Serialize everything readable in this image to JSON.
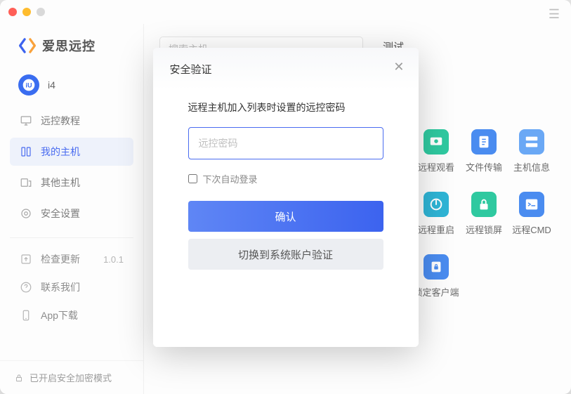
{
  "brand": {
    "name": "爱思远控"
  },
  "user": {
    "name": "i4"
  },
  "sidebar": {
    "items": [
      {
        "label": "远控教程"
      },
      {
        "label": "我的主机"
      },
      {
        "label": "其他主机"
      },
      {
        "label": "安全设置"
      }
    ],
    "utility": [
      {
        "label": "检查更新",
        "version": "1.0.1"
      },
      {
        "label": "联系我们"
      },
      {
        "label": "App下载"
      }
    ],
    "encrypt_label": "已开启安全加密模式"
  },
  "main": {
    "search_placeholder": "搜索主机",
    "host_title": "测试"
  },
  "actions": [
    {
      "label": "远程观看",
      "color": "#2fc9a0"
    },
    {
      "label": "文件传输",
      "color": "#4a8cf0"
    },
    {
      "label": "主机信息",
      "color": "#6aa8f5"
    },
    {
      "label": "远程重启",
      "color": "#2fb5d6"
    },
    {
      "label": "远程锁屏",
      "color": "#2fc9a0"
    },
    {
      "label": "远程CMD",
      "color": "#4a8cf0"
    },
    {
      "label": "锁定客户端",
      "color": "#4a8cf0"
    }
  ],
  "dialog": {
    "title": "安全验证",
    "subtitle": "远程主机加入列表时设置的远控密码",
    "password_placeholder": "远控密码",
    "auto_login_label": "下次自动登录",
    "confirm_label": "确认",
    "switch_label": "切换到系统账户验证"
  }
}
